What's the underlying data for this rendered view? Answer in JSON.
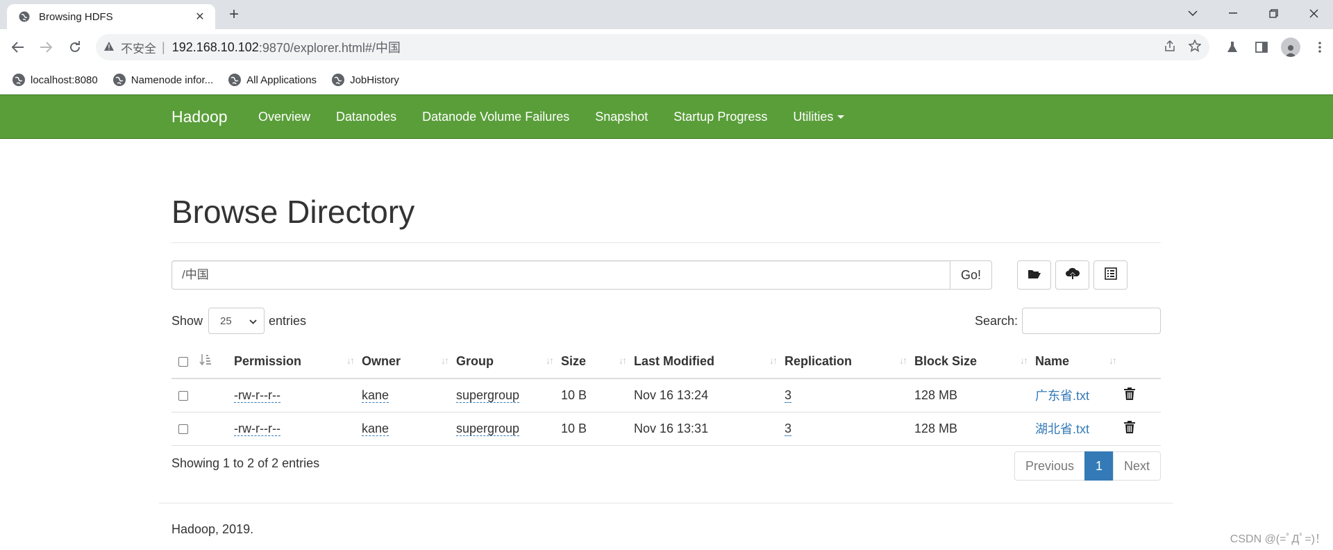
{
  "browser": {
    "tab_title": "Browsing HDFS",
    "security_label": "不安全",
    "url_host": "192.168.10.102",
    "url_rest": ":9870/explorer.html#/中国",
    "bookmarks": [
      {
        "label": "localhost:8080"
      },
      {
        "label": "Namenode infor..."
      },
      {
        "label": "All Applications"
      },
      {
        "label": "JobHistory"
      }
    ]
  },
  "navbar": {
    "brand": "Hadoop",
    "items": [
      "Overview",
      "Datanodes",
      "Datanode Volume Failures",
      "Snapshot",
      "Startup Progress",
      "Utilities"
    ],
    "color": "#5a9e3a"
  },
  "page": {
    "heading": "Browse Directory",
    "path_value": "/中国",
    "go_label": "Go!",
    "show_label": "Show",
    "entries_label": "entries",
    "page_length": "25",
    "search_label": "Search:",
    "columns": [
      "Permission",
      "Owner",
      "Group",
      "Size",
      "Last Modified",
      "Replication",
      "Block Size",
      "Name"
    ],
    "rows": [
      {
        "permission": "-rw-r--r--",
        "owner": "kane",
        "group": "supergroup",
        "size": "10 B",
        "modified": "Nov 16 13:24",
        "replication": "3",
        "block_size": "128 MB",
        "name": "广东省.txt"
      },
      {
        "permission": "-rw-r--r--",
        "owner": "kane",
        "group": "supergroup",
        "size": "10 B",
        "modified": "Nov 16 13:31",
        "replication": "3",
        "block_size": "128 MB",
        "name": "湖北省.txt"
      }
    ],
    "info": "Showing 1 to 2 of 2 entries",
    "pager": {
      "previous": "Previous",
      "current": "1",
      "next": "Next"
    },
    "footer": "Hadoop, 2019."
  },
  "watermark": "CSDN @(=ﾟДﾟ=)！"
}
